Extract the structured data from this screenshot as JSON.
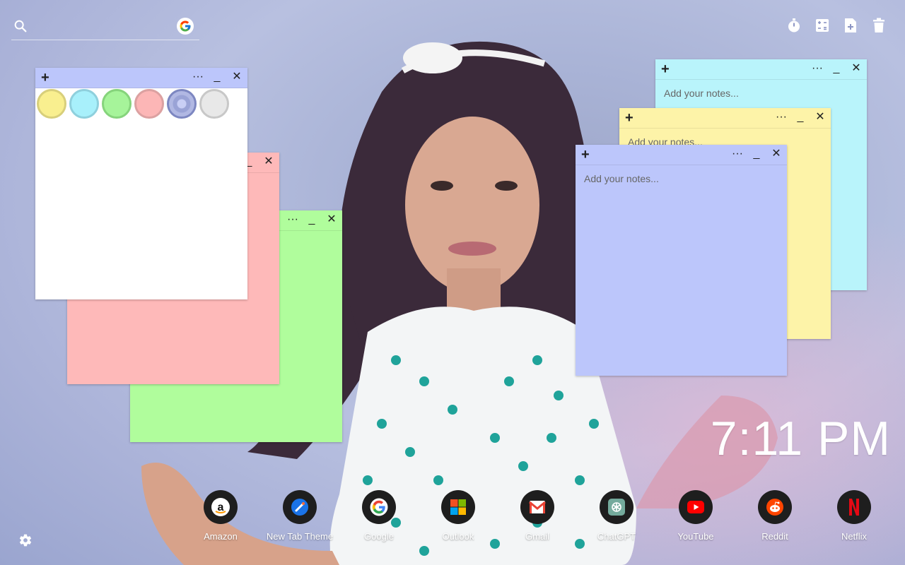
{
  "search": {
    "placeholder": ""
  },
  "tools": [
    "timer-icon",
    "calculator-icon",
    "new-note-icon",
    "trash-icon"
  ],
  "notes": [
    {
      "color": "#b9f4fb",
      "placeholder": "Add your notes..."
    },
    {
      "color": "#fdf3a8",
      "placeholder": "Add your notes..."
    },
    {
      "color": "#bcc6fb",
      "placeholder": "Add your notes..."
    },
    {
      "color": "#feb9b9",
      "placeholder": ""
    },
    {
      "color": "#b0fd9c",
      "placeholder": ""
    },
    {
      "color": "#ffffff",
      "placeholder": ""
    }
  ],
  "note_controls": {
    "add": "+",
    "more": "···",
    "minimize": "_",
    "close": "✕"
  },
  "color_swatches": [
    {
      "fill": "#f9ef8f",
      "border": "#d8cf7b"
    },
    {
      "fill": "#a8f0fb",
      "border": "#8fd0dd"
    },
    {
      "fill": "#a6f49a",
      "border": "#86d47c"
    },
    {
      "fill": "#fcb6b6",
      "border": "#dca1a1"
    },
    {
      "fill": "#9aa3d6",
      "border": "#7d87c1"
    },
    {
      "fill": "#e8e8e8",
      "border": "#c8c8c8"
    }
  ],
  "clock": {
    "time": "7:11 PM"
  },
  "shortcuts": [
    {
      "label": "Amazon",
      "icon": "amazon-icon"
    },
    {
      "label": "New Tab Theme",
      "icon": "new-tab-theme-icon"
    },
    {
      "label": "Google",
      "icon": "google-icon"
    },
    {
      "label": "Outlook",
      "icon": "outlook-icon"
    },
    {
      "label": "Gmail",
      "icon": "gmail-icon"
    },
    {
      "label": "ChatGPT",
      "icon": "chatgpt-icon"
    },
    {
      "label": "YouTube",
      "icon": "youtube-icon"
    },
    {
      "label": "Reddit",
      "icon": "reddit-icon"
    },
    {
      "label": "Netflix",
      "icon": "netflix-icon"
    }
  ]
}
